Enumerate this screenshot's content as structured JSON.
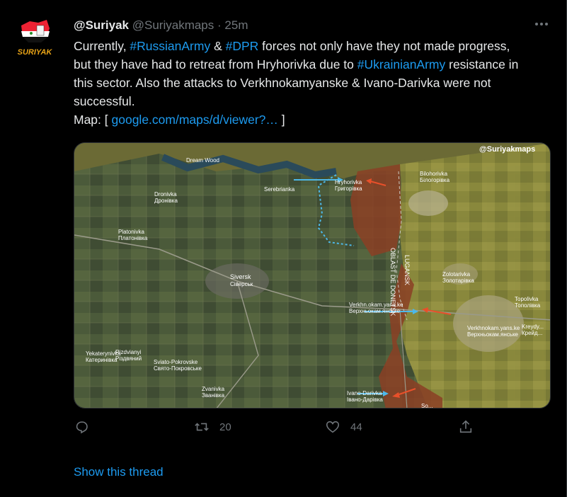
{
  "tweet": {
    "avatar_text": "SURIYAK",
    "display_name": "@Suriyak",
    "handle": "@Suriyakmaps",
    "separator": "·",
    "time": "25m",
    "text_segments": [
      {
        "text": "Currently, ",
        "type": "text"
      },
      {
        "text": "#RussianArmy",
        "type": "hashtag"
      },
      {
        "text": " & ",
        "type": "text"
      },
      {
        "text": "#DPR",
        "type": "hashtag"
      },
      {
        "text": " forces not only have they not made progress, but they have had to retreat from Hryhorivka due to ",
        "type": "text"
      },
      {
        "text": "#UkrainianArmy",
        "type": "hashtag"
      },
      {
        "text": " resistance in this sector. Also the attacks to Verkhnokamyanske & Ivano-Darivka were not successful.",
        "type": "text"
      },
      {
        "text": "Map: [ ",
        "type": "text"
      },
      {
        "text": "google.com/maps/d/viewer?…",
        "type": "link"
      },
      {
        "text": " ]",
        "type": "text"
      }
    ]
  },
  "map": {
    "watermark": "@Suriyakmaps",
    "labels": {
      "dream_wood": "Dream Wood",
      "serebrianka": "Serebrianka",
      "dronivka": "Dronivka",
      "dronivka_cyr": "Дронівка",
      "hryhorivka": "Hryhorivka",
      "hryhorivka_cyr": "Григорівка",
      "bilohorivka": "Bilohorivka",
      "bilohorivka_cyr": "Білогорівка",
      "platonivka": "Platonivka",
      "platonivka_cyr": "Платонівка",
      "siversk": "Siversk",
      "siversk_cyr": "Сіверськ",
      "oblast_donetsk": "OBLAST DE DONETSK",
      "lugansk": "LUGANSK",
      "zolotarivka": "Zolotarivka",
      "zolotarivka_cyr": "Золотарівка",
      "verkhnokamyanske": "Verkhn.okam.yans.ke",
      "verkhnokamyanske_cyr": "Верхньокам.янське",
      "topolivka": "Topolivka",
      "topolivka_cyr": "Тополівка",
      "verkhnokamyanske_east": "Verkhnokam.yans.ke",
      "verkhnokamyanske_east_cyr": "Верхньокам.янське",
      "rizdvianyi": "Rizdvianyi",
      "rizdvianyi_cyr": "Різдвяний",
      "yekaterynivka": "Yekaterynivka",
      "yekaterynivka_cyr": "Катеринівка",
      "sviato_pokrovske": "Sviato-Pokrovske",
      "sviato_pokrovske_cyr": "Свято-Покровське",
      "ivano_darivka": "Ivano-Darivka",
      "ivano_darivka_cyr": "Івано-Дарівка",
      "zvanivka": "Zvanivka",
      "zvanivka_cyr": "Званівка",
      "soledar_partial": "So...",
      "kreydyanka": "Kreydy...",
      "kreydyanka_cyr": "Крейд..."
    }
  },
  "actions": {
    "reply_count": "",
    "retweet_count": "20",
    "like_count": "44"
  },
  "show_thread": "Show this thread",
  "colors": {
    "accent": "#1d9bf0",
    "muted": "#71767b",
    "russian_zone": "#8b3f25",
    "ukraine_zone": "#4a5a3a",
    "arrow_ua": "#4db8e8",
    "arrow_ru": "#e8502a"
  }
}
